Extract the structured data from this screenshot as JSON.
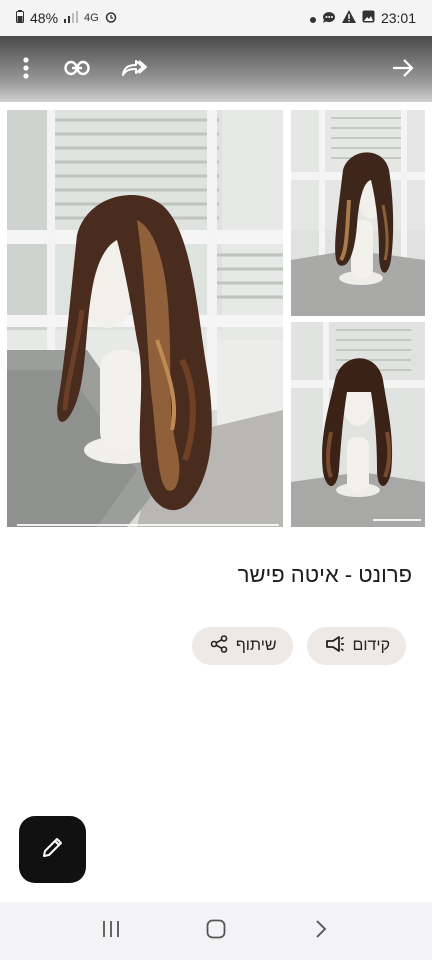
{
  "status_bar": {
    "battery": "48%",
    "network": "4G",
    "time": "23:01"
  },
  "toolbar": {
    "icons": [
      "more-vert-icon",
      "link-icon",
      "share-forward-icon",
      "arrow-right-icon"
    ]
  },
  "gallery": {
    "photos": [
      {
        "description_icon": "wig-on-mannequin-image"
      },
      {
        "description_icon": "wig-on-mannequin-image"
      },
      {
        "description_icon": "wig-on-mannequin-image"
      }
    ]
  },
  "product": {
    "title": "פרונט - איטה פישר"
  },
  "actions": {
    "promote_label": "קידום",
    "share_label": "שיתוף"
  },
  "fab": {
    "icon": "edit-pencil-icon"
  },
  "nav": {
    "icons": [
      "recent-apps-icon",
      "home-icon",
      "back-icon"
    ]
  }
}
